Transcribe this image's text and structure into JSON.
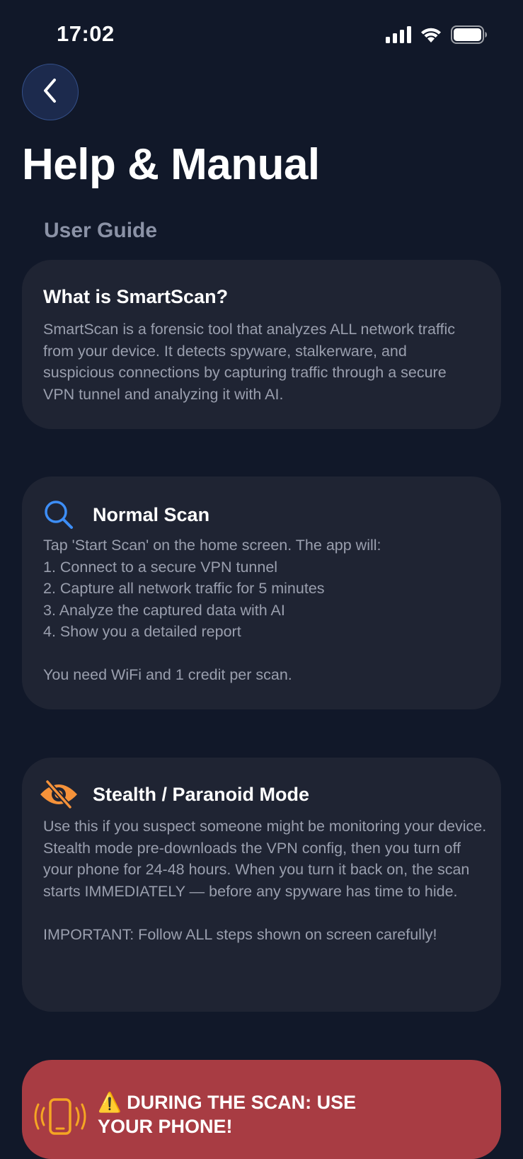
{
  "status_bar": {
    "time": "17:02"
  },
  "page": {
    "title": "Help & Manual",
    "section_label": "User Guide"
  },
  "cards": {
    "what_is": {
      "title": "What is SmartScan?",
      "body": "SmartScan is a forensic tool that analyzes ALL network traffic from your device. It detects spyware, stalkerware, and suspicious connections by capturing traffic through a secure VPN tunnel and analyzing it with AI."
    },
    "normal_scan": {
      "title": "Normal Scan",
      "icon": "search-icon",
      "body": "Tap 'Start Scan' on the home screen. The app will:\n1. Connect to a secure VPN tunnel\n2. Capture all network traffic for 5 minutes\n3. Analyze the captured data with AI\n4. Show you a detailed report\n\nYou need WiFi and 1 credit per scan."
    },
    "stealth": {
      "title": "Stealth / Paranoid Mode",
      "icon": "eye-slash-icon",
      "body": "Use this if you suspect someone might be monitoring your device. Stealth mode pre-downloads the VPN config, then you turn off your phone for 24-48 hours. When you turn it back on, the scan starts IMMEDIATELY — before any spyware has time to hide.\n\nIMPORTANT: Follow ALL steps shown on screen carefully!"
    },
    "during_scan": {
      "title": "⚠️ DURING THE SCAN: USE YOUR PHONE!",
      "icon": "phone-vibrate-icon"
    }
  },
  "colors": {
    "background": "#111829",
    "card": "#1f2433",
    "warning_card": "#a83c43",
    "accent_blue": "#3d8ef7",
    "accent_orange": "#f5923a"
  }
}
